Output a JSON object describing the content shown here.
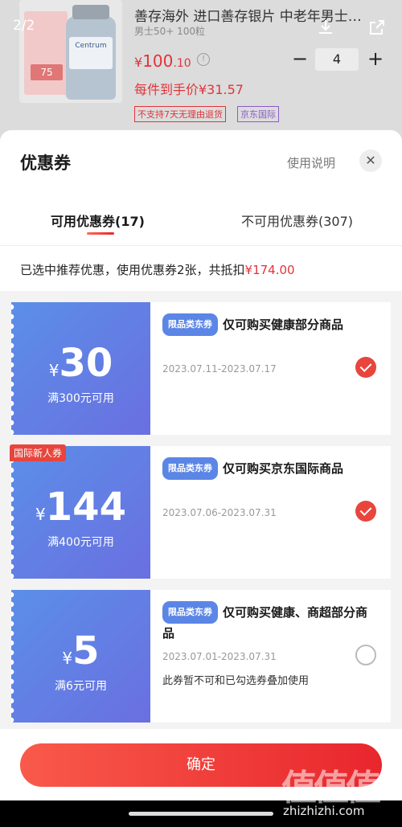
{
  "product": {
    "pager": "2/2",
    "thumb_promo_price": "75",
    "thumb_brand": "Centrum",
    "title": "善存海外 进口善存银片 中老年男士…",
    "subtitle": "男士50+ 100粒",
    "price_currency": "¥",
    "price_int": "100",
    "price_dec": ".10",
    "quantity": "4",
    "unit_price": "每件到手价¥31.57",
    "tag_no_return": "不支持7天无理由退货",
    "tag_intl": "京东国际"
  },
  "sheet": {
    "title": "优惠券",
    "help_link": "使用说明",
    "tabs": [
      {
        "label": "可用优惠券(17)",
        "active": true
      },
      {
        "label": "不可用优惠券(307)",
        "active": false
      }
    ],
    "summary_prefix": "已选中推荐优惠，使用优惠券2张，共抵扣",
    "summary_amount": "¥174.00",
    "coupons": [
      {
        "currency": "¥",
        "amount": "30",
        "condition": "满300元可用",
        "tag": "限品类东券",
        "desc": "仅可购买健康部分商品",
        "dates": "2023.07.11-2023.07.17",
        "selected": true
      },
      {
        "badge": "国际新人券",
        "currency": "¥",
        "amount": "144",
        "condition": "满400元可用",
        "tag": "限品类东券",
        "desc": "仅可购买京东国际商品",
        "dates": "2023.07.06-2023.07.31",
        "selected": true
      },
      {
        "currency": "¥",
        "amount": "5",
        "condition": "满6元可用",
        "tag": "限品类东券",
        "desc": "仅可购买健康、商超部分商品",
        "dates": "2023.07.01-2023.07.31",
        "note": "此券暂不可和已勾选券叠加使用",
        "selected": false
      }
    ],
    "confirm_label": "确定"
  },
  "watermark": {
    "logo": "值值值",
    "text": "zhizhizhi.com"
  },
  "colors": {
    "accent": "#e0343a",
    "coupon_blue": "#5b8fe8",
    "coupon_tag": "#5b86e6"
  }
}
